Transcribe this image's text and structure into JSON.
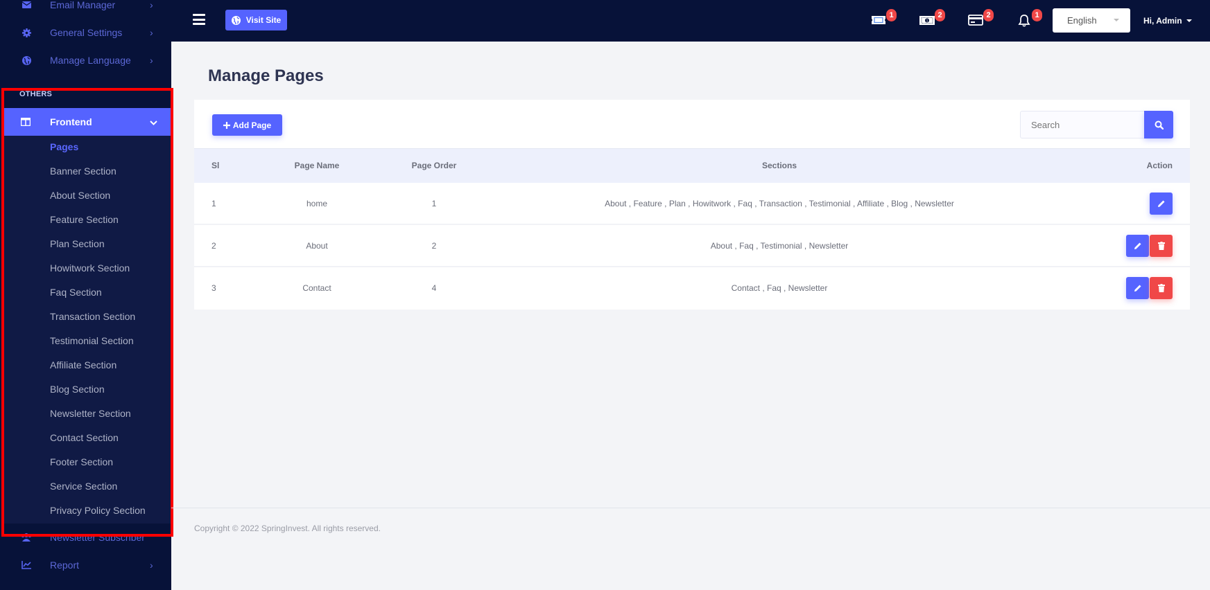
{
  "sidebar": {
    "top_items": [
      {
        "label": "Email Manager",
        "icon": "envelope-icon"
      },
      {
        "label": "General Settings",
        "icon": "gear-icon"
      },
      {
        "label": "Manage Language",
        "icon": "globe-icon"
      }
    ],
    "section_label": "OTHERS",
    "frontend": {
      "label": "Frontend",
      "icon": "layout-icon"
    },
    "submenu": [
      {
        "label": "Pages",
        "active": true
      },
      {
        "label": "Banner Section"
      },
      {
        "label": "About Section"
      },
      {
        "label": "Feature Section"
      },
      {
        "label": "Plan Section"
      },
      {
        "label": "Howitwork Section"
      },
      {
        "label": "Faq Section"
      },
      {
        "label": "Transaction Section"
      },
      {
        "label": "Testimonial Section"
      },
      {
        "label": "Affiliate Section"
      },
      {
        "label": "Blog Section"
      },
      {
        "label": "Newsletter Section"
      },
      {
        "label": "Contact Section"
      },
      {
        "label": "Footer Section"
      },
      {
        "label": "Service Section"
      },
      {
        "label": "Privacy Policy Section"
      }
    ],
    "bottom_items": [
      {
        "label": "Newsletter Subscriber",
        "icon": "users-icon"
      },
      {
        "label": "Report",
        "icon": "chart-line-icon"
      }
    ]
  },
  "header": {
    "visit_site_label": "Visit Site",
    "badges": {
      "ticket": "1",
      "money": "2",
      "card": "2",
      "bell": "1"
    },
    "language": "English",
    "user_label": "Hi, Admin"
  },
  "main": {
    "title": "Manage Pages",
    "add_page_label": "Add Page",
    "search_placeholder": "Search",
    "table": {
      "headers": {
        "sl": "Sl",
        "page_name": "Page Name",
        "page_order": "Page Order",
        "sections": "Sections",
        "action": "Action"
      },
      "rows": [
        {
          "sl": "1",
          "page_name": "home",
          "page_order": "1",
          "sections": "About , Feature , Plan , Howitwork , Faq , Transaction , Testimonial , Affiliate , Blog , Newsletter",
          "deletable": false
        },
        {
          "sl": "2",
          "page_name": "About",
          "page_order": "2",
          "sections": "About , Faq , Testimonial , Newsletter",
          "deletable": true
        },
        {
          "sl": "3",
          "page_name": "Contact",
          "page_order": "4",
          "sections": "Contact , Faq , Newsletter",
          "deletable": true
        }
      ]
    }
  },
  "footer": {
    "copyright": "Copyright © 2022 SpringInvest. All rights reserved."
  },
  "colors": {
    "primary": "#5563ff",
    "danger": "#f04848",
    "sidebar_bg": "#071239",
    "highlight": "#ff0000"
  }
}
